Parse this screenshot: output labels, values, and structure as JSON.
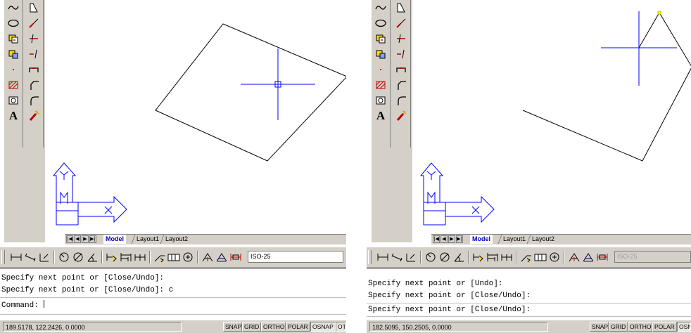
{
  "left": {
    "draw_tools_col1": [
      "spline-icon",
      "ellipse-icon",
      "insert-block-icon",
      "make-block-icon",
      "point-icon",
      "hatch-icon",
      "region-icon",
      "multiline-text-icon"
    ],
    "draw_tools_col2": [
      "stretch-icon",
      "scale-icon",
      "trim-icon",
      "extend-icon",
      "break-icon",
      "chamfer-icon",
      "fillet-icon",
      "explode-icon"
    ],
    "text_tool_glyph": "A",
    "ucs": {
      "y_label": "Y",
      "x_label": "X",
      "w_label": "W"
    },
    "layout_tabs": [
      "Model",
      "Layout1",
      "Layout2"
    ],
    "nav_buttons": [
      "|◀",
      "◀",
      "▶",
      "▶|"
    ],
    "dim_style": "ISO-25",
    "command_lines": [
      "Specify next point or [Close/Undo]:",
      "Specify next point or [Close/Undo]: c",
      "Command:"
    ],
    "coords": "189.5178, 122.2426, 0.0000",
    "status_buttons": [
      {
        "label": "SNAP",
        "on": false
      },
      {
        "label": "GRID",
        "on": false
      },
      {
        "label": "ORTHO",
        "on": false
      },
      {
        "label": "POLAR",
        "on": false
      },
      {
        "label": "OSNAP",
        "on": true
      },
      {
        "label": "OTR",
        "on": true
      }
    ]
  },
  "right": {
    "draw_tools_col1": [
      "spline-icon",
      "ellipse-icon",
      "insert-block-icon",
      "make-block-icon",
      "point-icon",
      "hatch-icon",
      "region-icon",
      "multiline-text-icon"
    ],
    "draw_tools_col2": [
      "stretch-icon",
      "scale-icon",
      "trim-icon",
      "extend-icon",
      "break-icon",
      "chamfer-icon",
      "fillet-icon",
      "explode-icon"
    ],
    "text_tool_glyph": "A",
    "ucs": {
      "y_label": "Y",
      "x_label": "X",
      "w_label": "W"
    },
    "layout_tabs": [
      "Model",
      "Layout1",
      "Layout2"
    ],
    "nav_buttons": [
      "|◀",
      "◀",
      "▶",
      "▶|"
    ],
    "dim_style": "ISO-25",
    "command_lines": [
      "Specify next point or [Undo]:",
      "Specify next point or [Close/Undo]:",
      "Specify next point or [Close/Undo]:"
    ],
    "coords": "182.5095, 150.2505, 0.0000",
    "status_buttons": [
      {
        "label": "SNAP",
        "on": false
      },
      {
        "label": "GRID",
        "on": false
      },
      {
        "label": "ORTHO",
        "on": false
      },
      {
        "label": "POLAR",
        "on": false
      },
      {
        "label": "OSNAP",
        "on": true
      }
    ]
  },
  "colors": {
    "cursor": "#0000ff",
    "ucs": "#0000ff",
    "geometry": "#000000",
    "grip": "#ffff00",
    "toolbar_bg": "#d4d0c8"
  }
}
